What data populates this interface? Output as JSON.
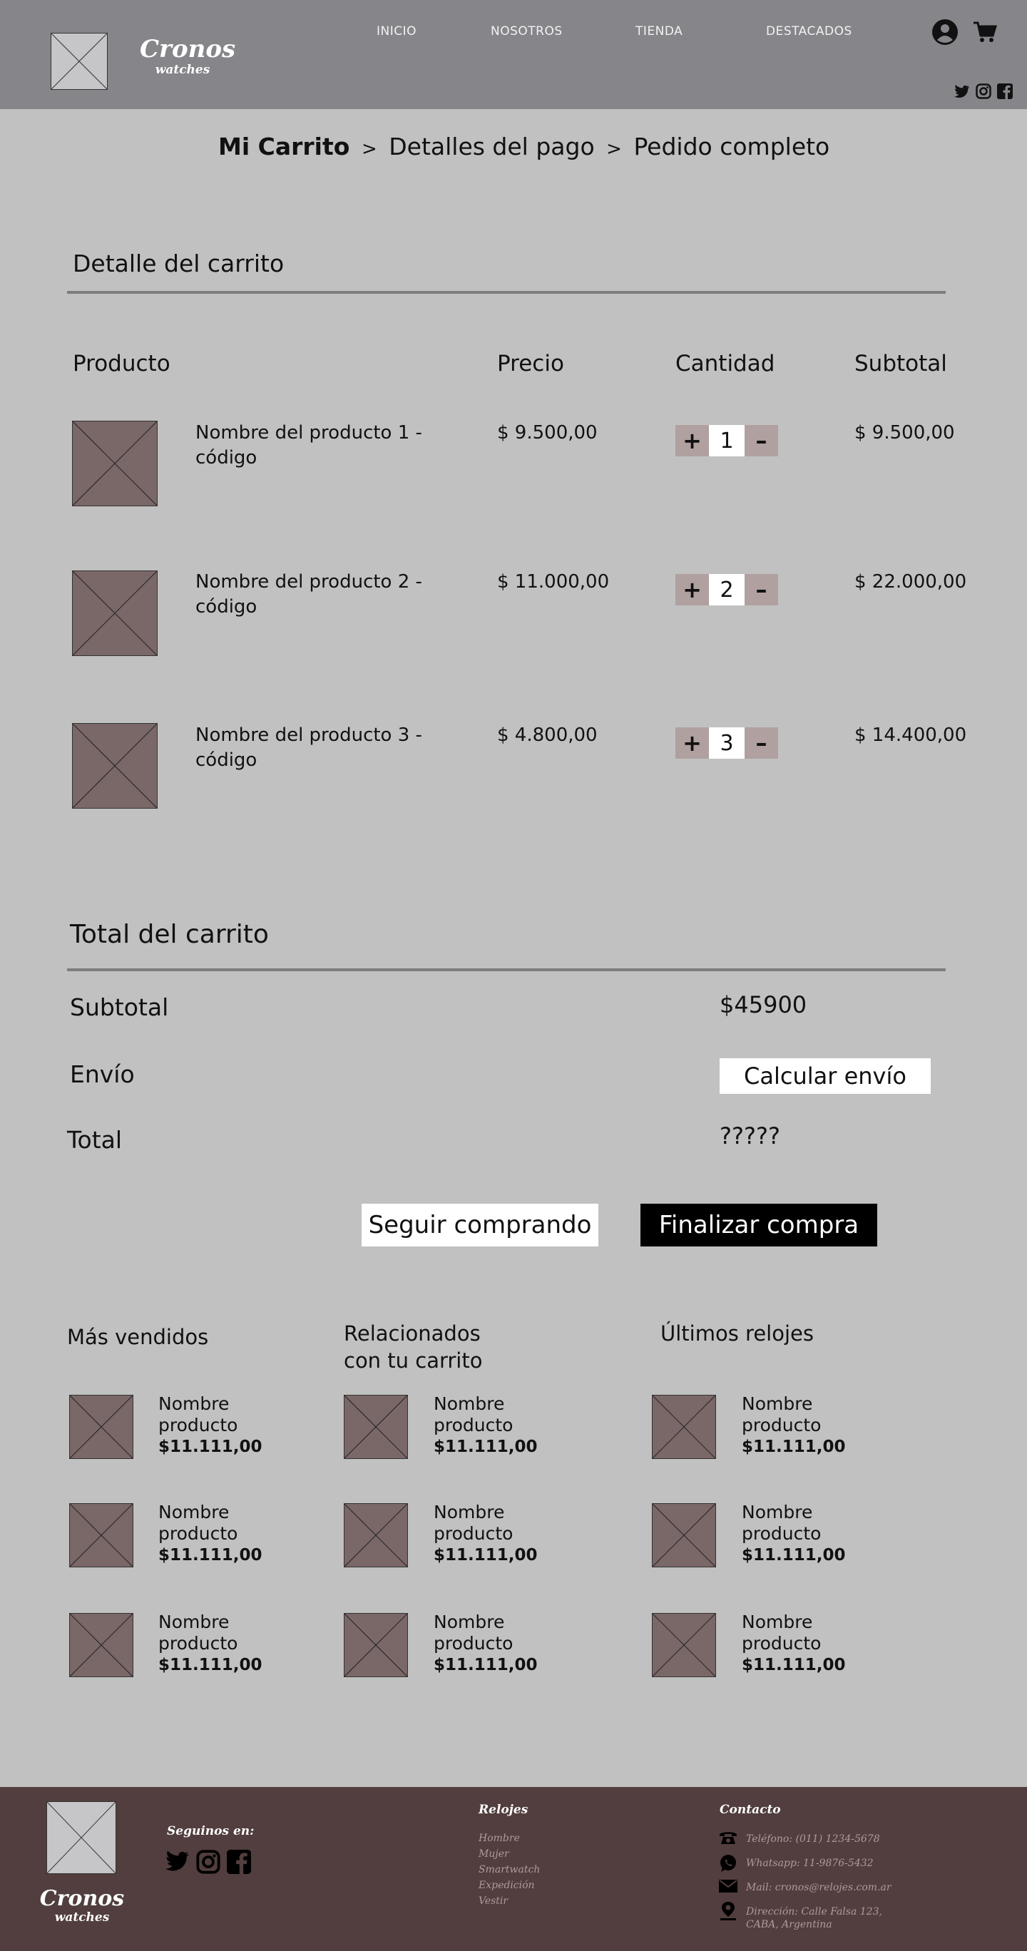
{
  "header": {
    "brand_name": "Cronos",
    "brand_tagline": "watches",
    "nav": [
      "INICIO",
      "NOSOTROS",
      "TIENDA",
      "DESTACADOS"
    ]
  },
  "breadcrumb": {
    "step1": "Mi Carrito",
    "sep": ">",
    "step2": "Detalles del pago",
    "step3": "Pedido completo"
  },
  "cart": {
    "title": "Detalle del carrito",
    "columns": [
      "Producto",
      "Precio",
      "Cantidad",
      "Subtotal"
    ],
    "plus": "+",
    "minus": "–",
    "items": [
      {
        "name": "Nombre del producto 1 - código",
        "price": "$ 9.500,00",
        "qty": "1",
        "subtotal": "$ 9.500,00"
      },
      {
        "name": "Nombre del producto 2 - código",
        "price": "$ 11.000,00",
        "qty": "2",
        "subtotal": "$ 22.000,00"
      },
      {
        "name": "Nombre del producto 3 - código",
        "price": "$ 4.800,00",
        "qty": "3",
        "subtotal": "$ 14.400,00"
      }
    ]
  },
  "totals": {
    "title": "Total del carrito",
    "subtotal_label": "Subtotal",
    "subtotal_value": "$45900",
    "shipping_label": "Envío",
    "shipping_button": "Calcular envío",
    "total_label": "Total",
    "total_value": "?????"
  },
  "actions": {
    "continue": "Seguir comprando",
    "checkout": "Finalizar compra"
  },
  "lists": [
    {
      "title": "Más vendidos"
    },
    {
      "title": "Relacionados con tu carrito"
    },
    {
      "title": "Últimos relojes"
    }
  ],
  "mini_product": {
    "name": "Nombre producto",
    "price": "$11.111,00"
  },
  "footer": {
    "brand_name": "Cronos",
    "brand_tagline": "watches",
    "follow": "Seguinos en:",
    "relojes_title": "Relojes",
    "relojes_links": [
      "Hombre",
      "Mujer",
      "Smartwatch",
      "Expedición",
      "Vestir"
    ],
    "contacto_title": "Contacto",
    "contacts": [
      {
        "icon": "phone-icon",
        "text": "Teléfono: (011) 1234-5678"
      },
      {
        "icon": "whatsapp-icon",
        "text": "Whatsapp: 11-9876-5432"
      },
      {
        "icon": "mail-icon",
        "text": "Mail: cronos@relojes.com.ar"
      },
      {
        "icon": "location-icon",
        "text": "Dirección: Calle Falsa 123, CABA, Argentina"
      }
    ]
  }
}
